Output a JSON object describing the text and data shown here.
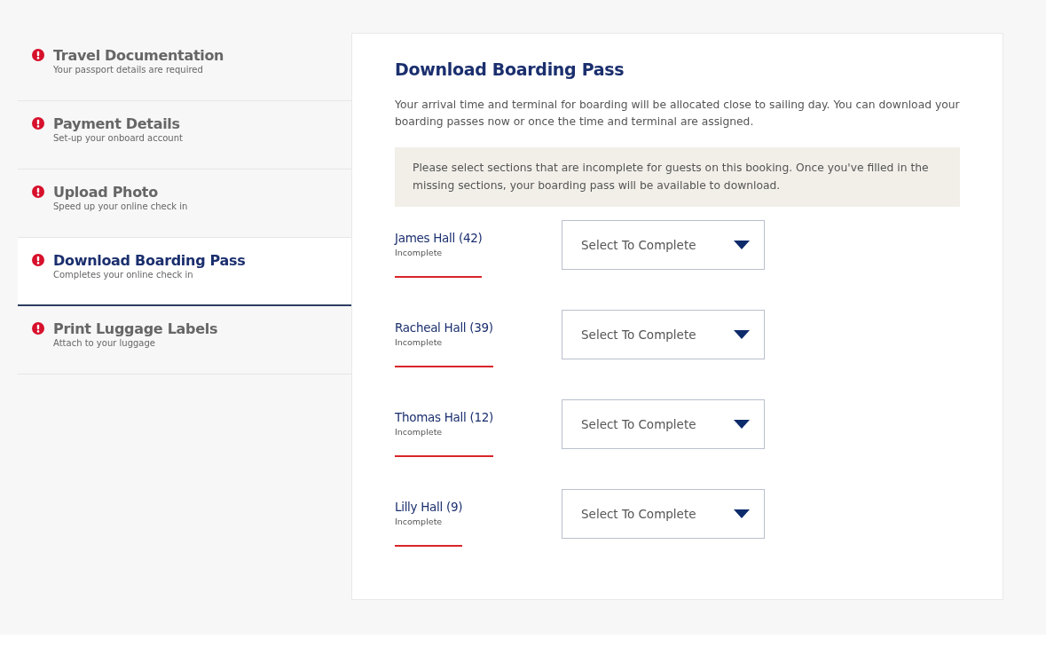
{
  "steps": [
    {
      "title": "Travel Documentation",
      "subtitle": "Your passport details are required",
      "selected": false
    },
    {
      "title": "Payment Details",
      "subtitle": "Set-up your onboard account",
      "selected": false
    },
    {
      "title": "Upload Photo",
      "subtitle": "Speed up your online check in",
      "selected": false
    },
    {
      "title": "Download Boarding Pass",
      "subtitle": "Completes your online check in",
      "selected": true
    },
    {
      "title": "Print Luggage Labels",
      "subtitle": "Attach to your luggage",
      "selected": false
    }
  ],
  "panel": {
    "title": "Download Boarding Pass",
    "intro": "Your arrival time and terminal for boarding will be allocated close to sailing day. You can download your boarding passes now or once the time and terminal are assigned.",
    "notice": "Please select sections that are incomplete for guests on this booking. Once you've filled in the missing sections, your boarding pass will be available to download.",
    "guests": [
      {
        "name": "James Hall (42)",
        "status": "Incomplete",
        "select": "Select To Complete"
      },
      {
        "name": "Racheal Hall (39)",
        "status": "Incomplete",
        "select": "Select To Complete"
      },
      {
        "name": "Thomas Hall (12)",
        "status": "Incomplete",
        "select": "Select To Complete"
      },
      {
        "name": "Lilly Hall (9)",
        "status": "Incomplete",
        "select": "Select To Complete"
      }
    ]
  }
}
